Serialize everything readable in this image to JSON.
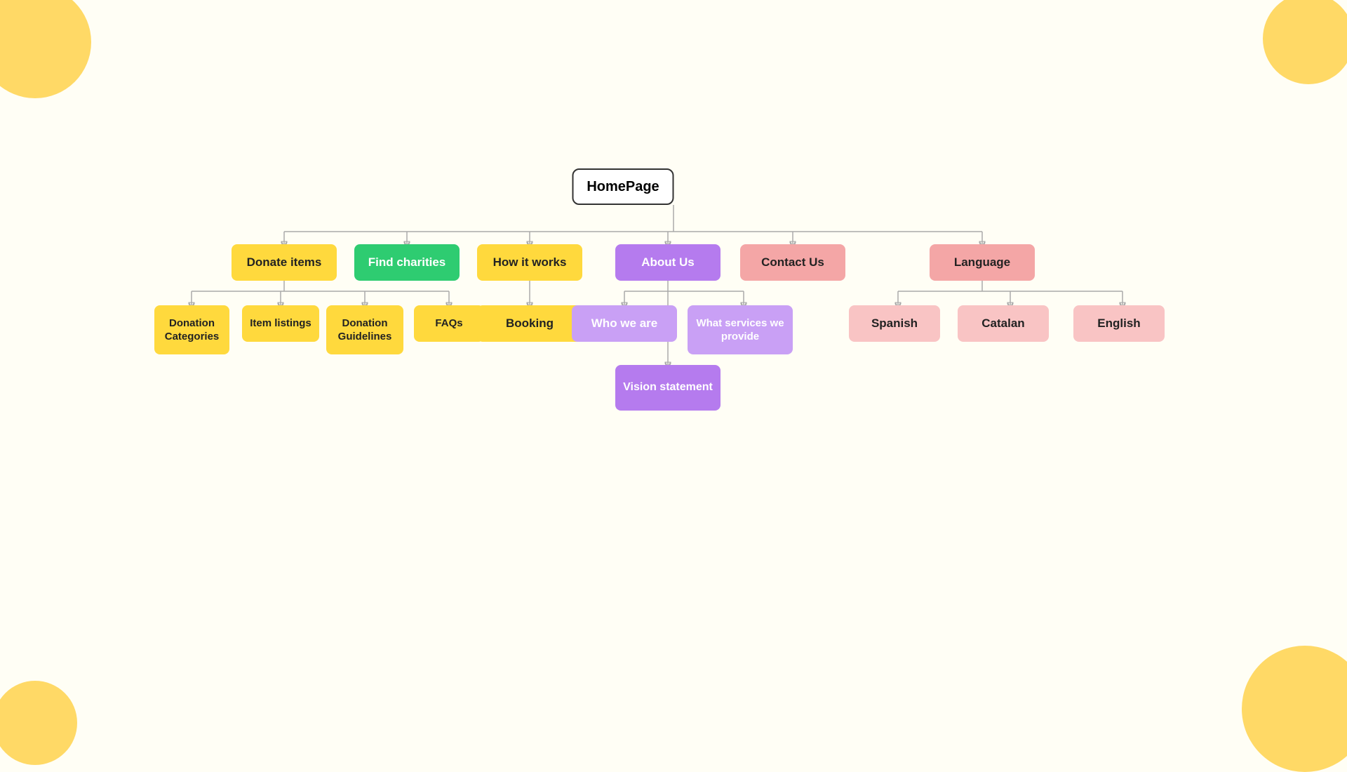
{
  "nodes": {
    "homepage": "HomePage",
    "donate_items": "Donate items",
    "find_charities": "Find charities",
    "how_it_works": "How it works",
    "about_us": "About Us",
    "contact_us": "Contact Us",
    "language": "Language",
    "donation_categories": "Donation Categories",
    "item_listings": "Item listings",
    "donation_guidelines": "Donation Guidelines",
    "faqs": "FAQs",
    "booking": "Booking",
    "who_we_are": "Who we are",
    "what_services": "What services we provide",
    "vision_statement": "Vision statement",
    "spanish": "Spanish",
    "catalan": "Catalan",
    "english": "English"
  }
}
